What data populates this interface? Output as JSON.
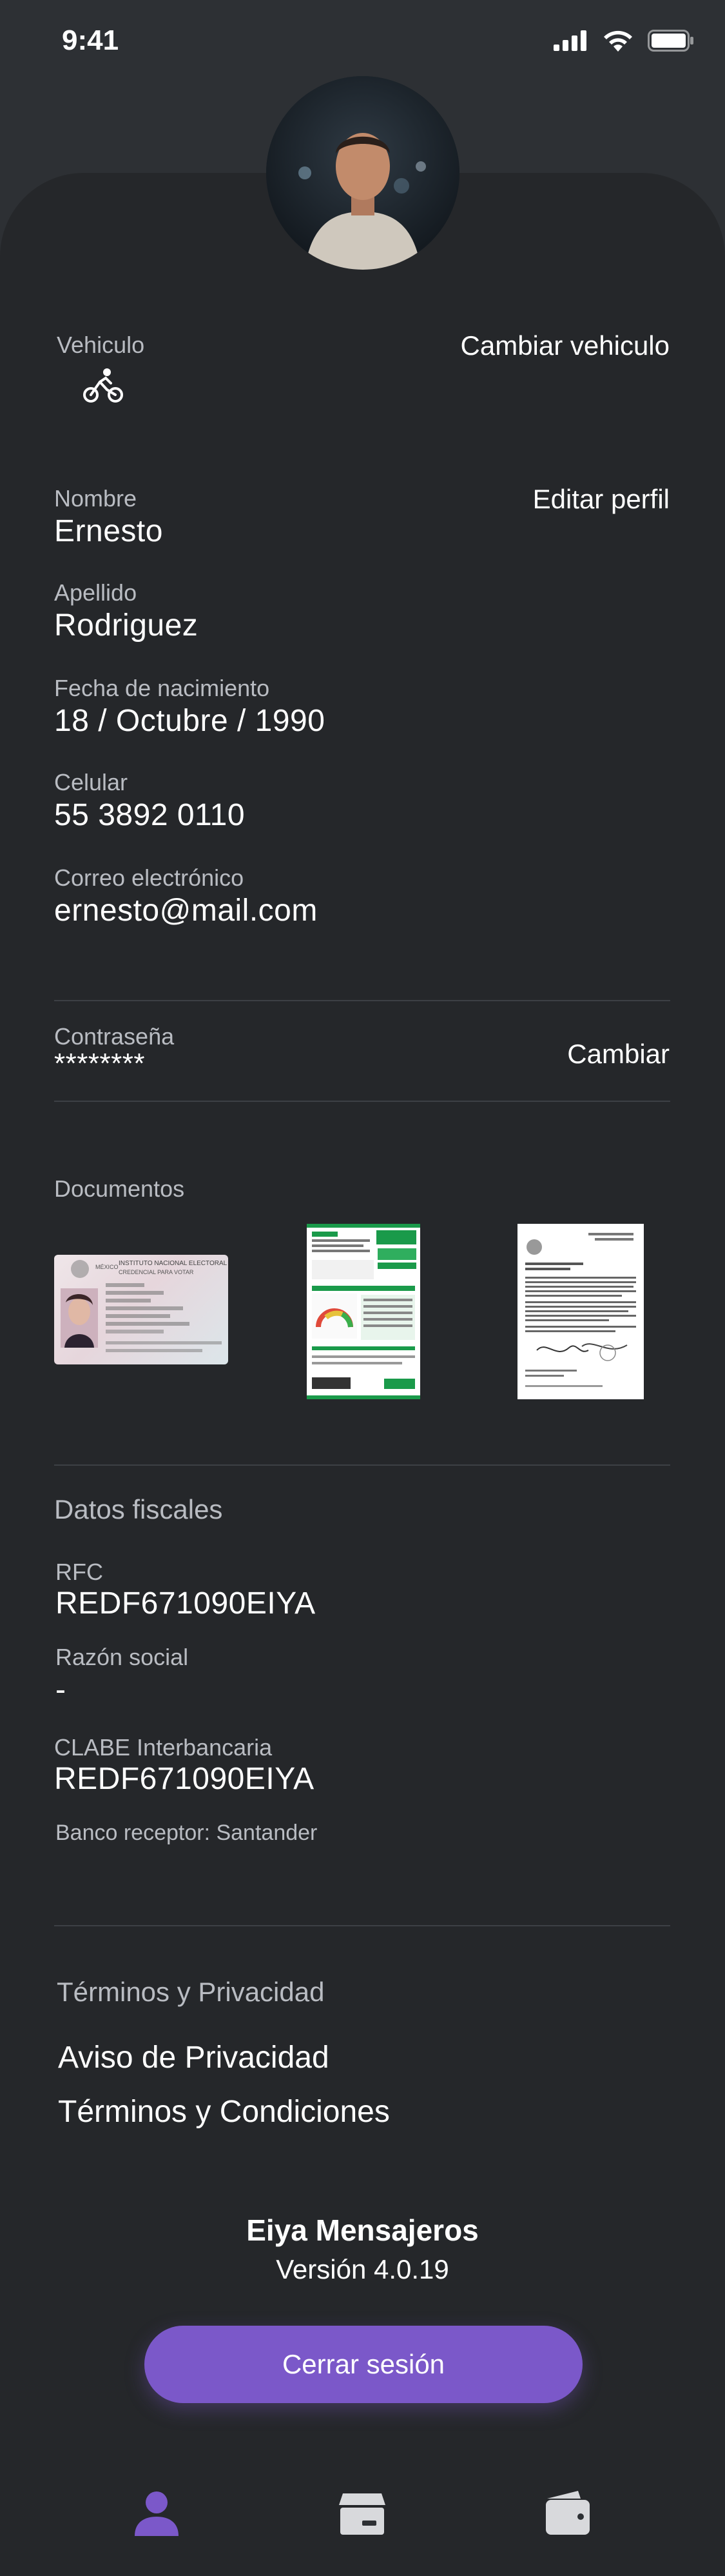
{
  "status_bar": {
    "time": "9:41",
    "icons": [
      "signal-icon",
      "wifi-icon",
      "battery-icon"
    ]
  },
  "profile": {
    "avatar": "avatar"
  },
  "vehicle": {
    "label": "Vehiculo",
    "icon": "bicycle-icon",
    "change_label": "Cambiar vehiculo"
  },
  "personal": {
    "edit_label": "Editar perfil",
    "fields": [
      {
        "label": "Nombre",
        "value": "Ernesto"
      },
      {
        "label": "Apellido",
        "value": "Rodriguez"
      },
      {
        "label": "Fecha de nacimiento",
        "value": "18 / Octubre / 1990"
      },
      {
        "label": "Celular",
        "value": "55 3892 0110"
      },
      {
        "label": "Correo electrónico",
        "value": "ernesto@mail.com"
      }
    ]
  },
  "password": {
    "label": "Contraseña",
    "value": "********",
    "change_label": "Cambiar"
  },
  "documents": {
    "title": "Documentos",
    "ine": {
      "line1": "INSTITUTO NACIONAL ELECTORAL",
      "line2": "CREDENCIAL PARA VOTAR",
      "country": "MÉXICO"
    }
  },
  "fiscal": {
    "title": "Datos fiscales",
    "rfc_label": "RFC",
    "rfc_value": "REDF671090EIYA",
    "razon_label": "Razón social",
    "razon_value": "-",
    "clabe_label": "CLABE Interbancaria",
    "clabe_value": "REDF671090EIYA",
    "bank": "Banco receptor: Santander"
  },
  "terms": {
    "title": "Términos y Privacidad",
    "privacy": "Aviso de Privacidad",
    "conditions": "Términos y Condiciones"
  },
  "app": {
    "name": "Eiya Mensajeros",
    "version": "Versión 4.0.19"
  },
  "logout_label": "Cerrar sesión",
  "tabbar": {
    "items": [
      "profile-tab",
      "orders-tab",
      "wallet-tab"
    ],
    "active_color": "#7b58c9",
    "inactive_color": "#d8d9dc"
  }
}
